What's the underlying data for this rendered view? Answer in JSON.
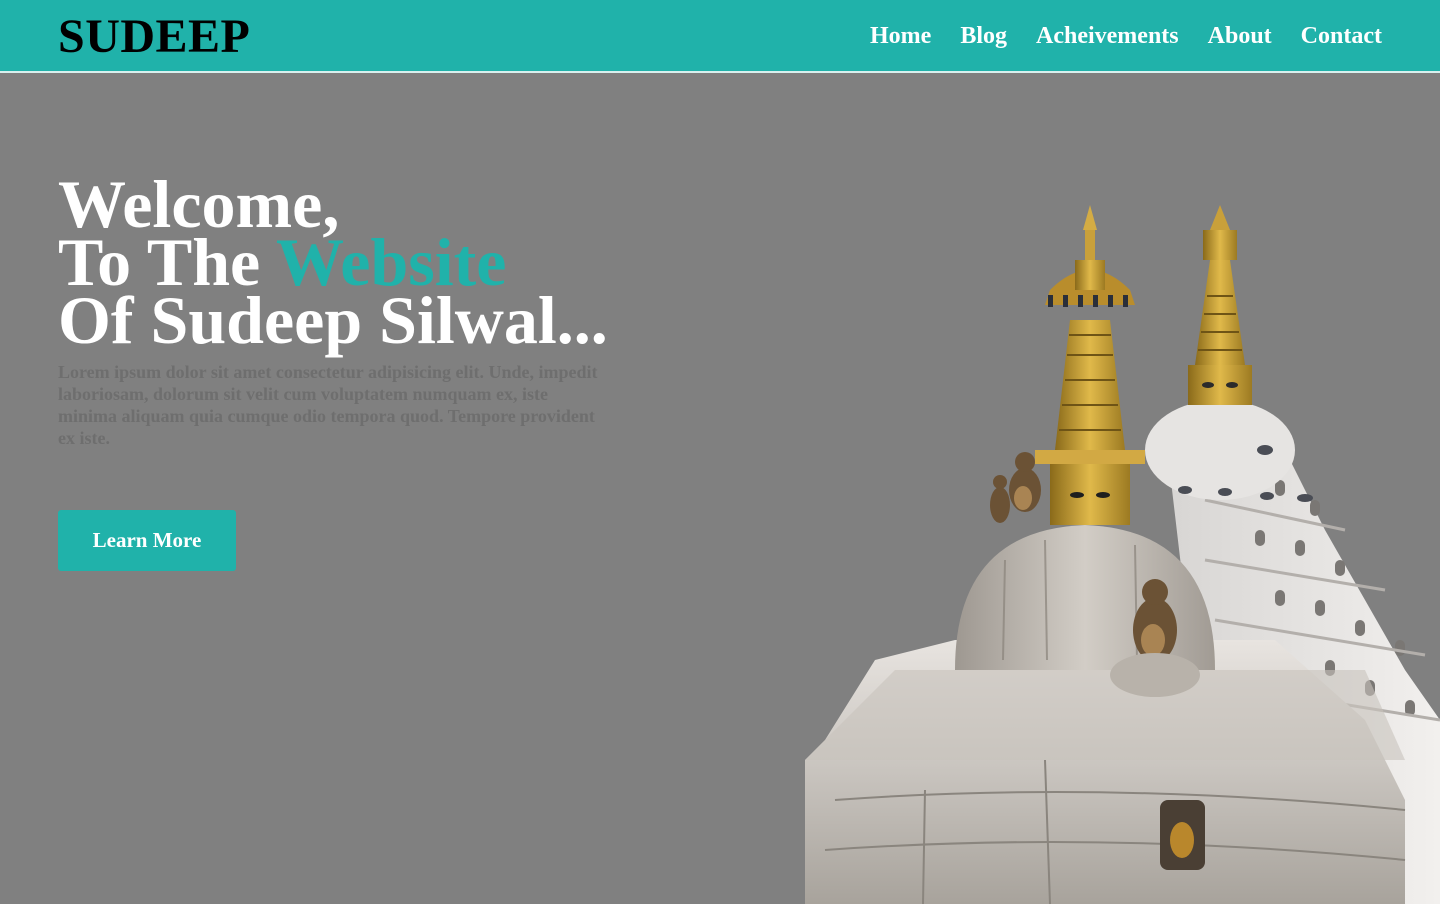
{
  "brand": {
    "logo": "SUDEEP",
    "accent_color": "#20b2aa",
    "background_color": "#808080"
  },
  "nav": {
    "items": [
      {
        "label": "Home"
      },
      {
        "label": "Blog"
      },
      {
        "label": "Acheivements"
      },
      {
        "label": "About"
      },
      {
        "label": "Contact"
      }
    ]
  },
  "hero": {
    "line1": "Welcome,",
    "line2_prefix": "To The ",
    "line2_accent": "Website",
    "line3": "Of Sudeep Silwal...",
    "description": "Lorem ipsum dolor sit amet consectetur adipisicing elit. Unde, impedit laboriosam, dolorum sit velit cum voluptatem numquam ex, iste minima aliquam quia cumque odio tempora quod. Tempore provident ex iste.",
    "cta_label": "Learn More",
    "image": "stupa-with-monkeys-photo"
  }
}
